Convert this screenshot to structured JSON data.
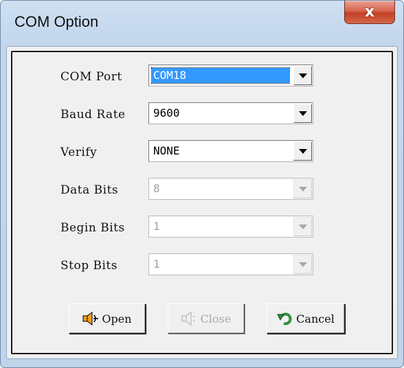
{
  "window": {
    "title": "COM Option",
    "close_glyph": "x"
  },
  "form": {
    "rows": [
      {
        "label": "COM Port",
        "value": "COM18",
        "enabled": true,
        "selected": true
      },
      {
        "label": "Baud Rate",
        "value": "9600",
        "enabled": true,
        "selected": false
      },
      {
        "label": "Verify",
        "value": "NONE",
        "enabled": true,
        "selected": false
      },
      {
        "label": "Data Bits",
        "value": "8",
        "enabled": false,
        "selected": false
      },
      {
        "label": "Begin Bits",
        "value": "1",
        "enabled": false,
        "selected": false
      },
      {
        "label": "Stop Bits",
        "value": "1",
        "enabled": false,
        "selected": false
      }
    ]
  },
  "buttons": {
    "open": {
      "label": "Open",
      "icon": "open-port-icon",
      "enabled": true
    },
    "close": {
      "label": "Close",
      "icon": "close-port-icon",
      "enabled": false
    },
    "cancel": {
      "label": "Cancel",
      "icon": "undo-arrow-icon",
      "enabled": true
    }
  },
  "colors": {
    "selection": "#3399ff",
    "close_button": "#c33f27",
    "icon_orange": "#f0a020",
    "icon_green": "#2f8f3a"
  }
}
